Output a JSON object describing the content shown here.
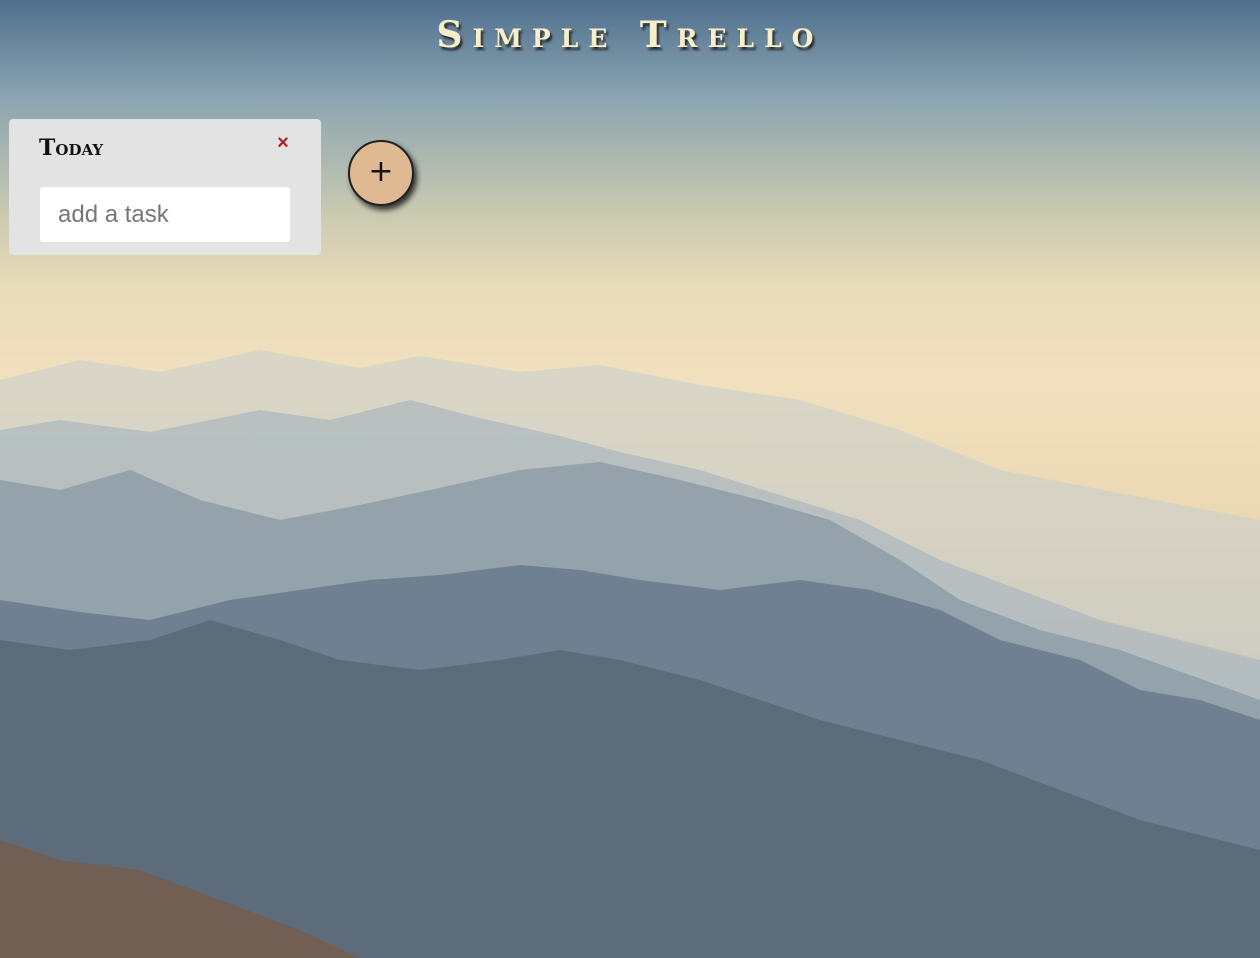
{
  "app": {
    "title": "Simple Trello"
  },
  "lists": [
    {
      "title": "Today",
      "close_icon": "×",
      "task_input": {
        "value": "",
        "placeholder": "add a task"
      }
    }
  ],
  "add_list_button": {
    "label": "+"
  },
  "colors": {
    "title_text": "#f7efc9",
    "list_bg": "#e3e3e3",
    "close_icon": "#b22222",
    "add_button_bg": "#deb991"
  },
  "icons": {
    "close": "close-icon",
    "add": "plus-icon"
  }
}
